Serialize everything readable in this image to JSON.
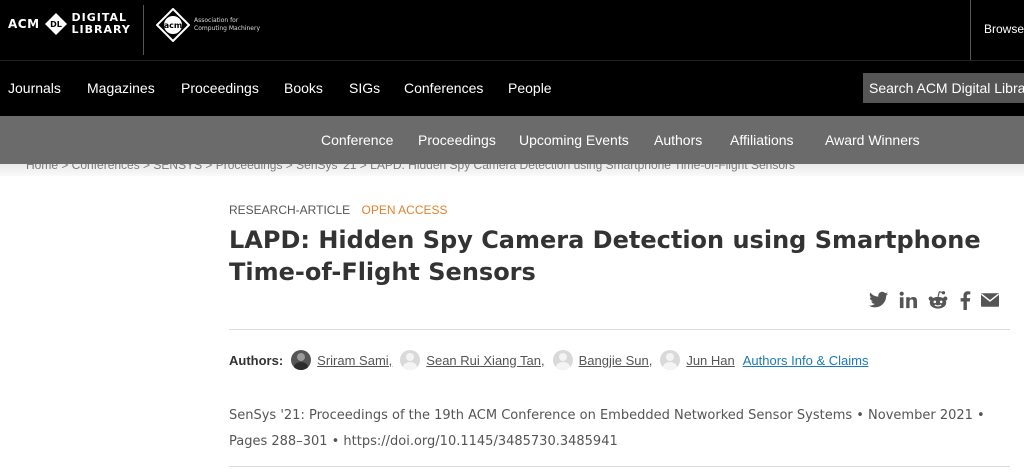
{
  "header": {
    "dl_logo": {
      "acm": "ACM",
      "mark": "DL",
      "line1": "DIGITAL",
      "line2": "LIBRARY"
    },
    "acm_logo": {
      "mark": "acm",
      "line1": "Association for",
      "line2": "Computing Machinery"
    },
    "browse": "Browse"
  },
  "nav": {
    "items": [
      "Journals",
      "Magazines",
      "Proceedings",
      "Books",
      "SIGs",
      "Conferences",
      "People"
    ],
    "search_placeholder": "Search ACM Digital Library"
  },
  "subnav": {
    "items": [
      "Conference",
      "Proceedings",
      "Upcoming Events",
      "Authors",
      "Affiliations",
      "Award Winners"
    ]
  },
  "breadcrumb": "Home  >  Conferences  >  SENSYS  >  Proceedings  >  SenSys '21  >  LAPD: Hidden Spy Camera Detection using Smartphone Time-of-Flight Sensors",
  "article": {
    "type": "RESEARCH-ARTICLE",
    "access": "OPEN ACCESS",
    "title": "LAPD: Hidden Spy Camera Detection using Smartphone Time-of-Flight Sensors",
    "share_icons": [
      "twitter-icon",
      "linkedin-icon",
      "reddit-icon",
      "facebook-icon",
      "email-icon"
    ],
    "authors_label": "Authors:",
    "authors": [
      "Sriram Sami,",
      "Sean Rui Xiang Tan,",
      "Bangjie Sun,",
      "Jun Han"
    ],
    "authors_info": "Authors Info & Claims",
    "publication": "SenSys '21: Proceedings of the 19th ACM Conference on Embedded Networked Sensor Systems • November 2021  • Pages 288–301 • https://doi.org/10.1145/3485730.3485941"
  },
  "colors": {
    "open_access": "#e2822e",
    "link": "#1d7cb4",
    "subnav_bg": "#6b6b6b"
  }
}
